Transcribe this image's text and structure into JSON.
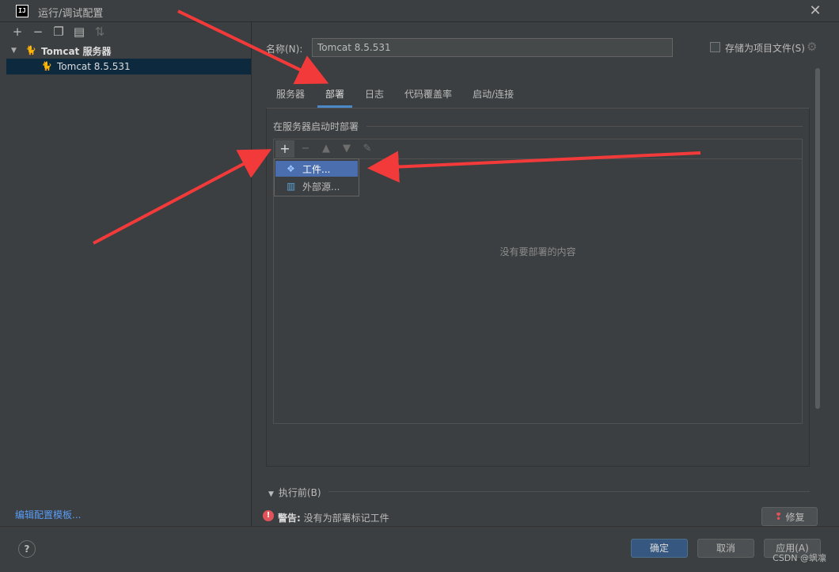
{
  "window": {
    "title": "运行/调试配置",
    "logo": "IJ"
  },
  "left": {
    "toolbar_icons": [
      "add-icon",
      "remove-icon",
      "copy-icon",
      "folder-icon",
      "sort-icon"
    ],
    "group_label": "Tomcat 服务器",
    "item_label": "Tomcat 8.5.531",
    "edit_templates": "编辑配置模板..."
  },
  "config": {
    "name_label": "名称(N):",
    "name_value": "Tomcat 8.5.531",
    "store_label": "存储为项目文件(S)"
  },
  "tabs": [
    {
      "label": "服务器",
      "active": false
    },
    {
      "label": "部署",
      "active": true
    },
    {
      "label": "日志",
      "active": false
    },
    {
      "label": "代码覆盖率",
      "active": false
    },
    {
      "label": "启动/连接",
      "active": false
    }
  ],
  "deploy": {
    "section_title": "在服务器启动时部署",
    "empty_text": "没有要部署的内容",
    "toolbar_icons": [
      "add-icon",
      "remove-icon",
      "move-up-icon",
      "move-down-icon",
      "edit-icon"
    ],
    "popup": {
      "artifact_label": "工件...",
      "external_label": "外部源..."
    }
  },
  "before_run": {
    "label": "执行前(B)"
  },
  "warning": {
    "prefix": "警告:",
    "text": "没有为部署标记工件",
    "fix_label": "修复"
  },
  "footer": {
    "help": "?",
    "ok": "确定",
    "cancel": "取消",
    "apply": "应用(A)",
    "watermark": "CSDN @飒凛"
  },
  "colors": {
    "accent": "#4a88c7",
    "selection": "#0d293e",
    "popup_highlight": "#4b6eaf",
    "arrow": "#f23a3a",
    "warning": "#e0535b"
  }
}
